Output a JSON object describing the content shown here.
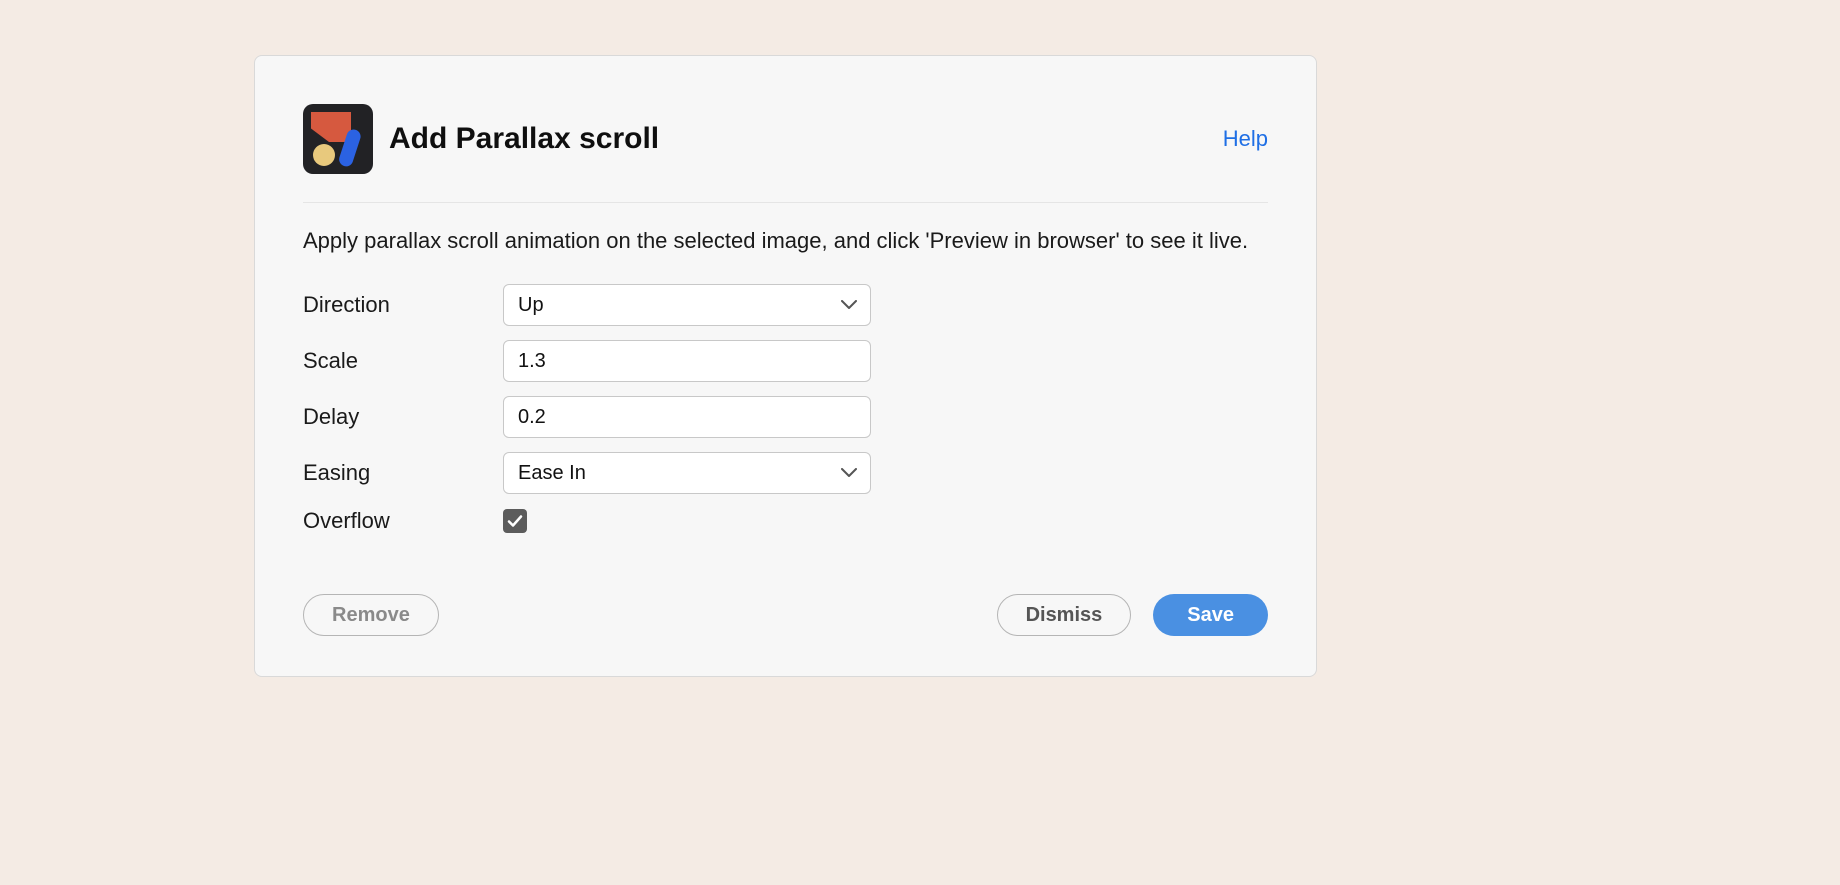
{
  "header": {
    "title": "Add Parallax scroll",
    "help_label": "Help"
  },
  "description": "Apply parallax scroll animation on the selected image, and click 'Preview in browser' to see it live.",
  "fields": {
    "direction": {
      "label": "Direction",
      "value": "Up"
    },
    "scale": {
      "label": "Scale",
      "value": "1.3"
    },
    "delay": {
      "label": "Delay",
      "value": "0.2"
    },
    "easing": {
      "label": "Easing",
      "value": "Ease In"
    },
    "overflow": {
      "label": "Overflow",
      "checked": true
    }
  },
  "buttons": {
    "remove": "Remove",
    "dismiss": "Dismiss",
    "save": "Save"
  },
  "colors": {
    "accent_link": "#1f6fe5",
    "primary_button": "#4a90e2",
    "panel_bg": "#f7f7f7",
    "page_bg": "#f4ebe4"
  }
}
